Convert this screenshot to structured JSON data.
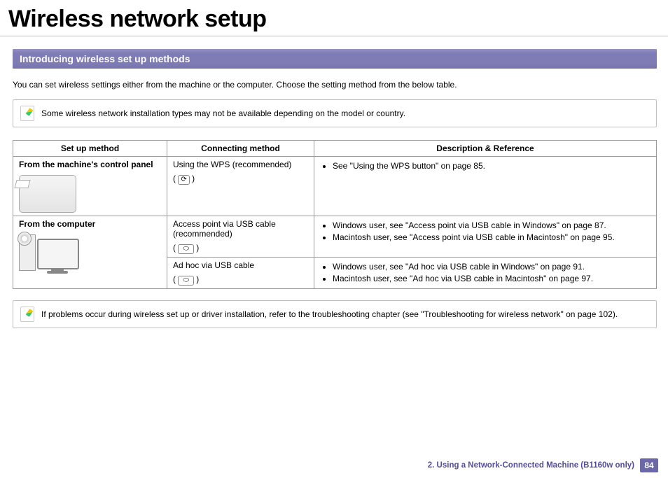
{
  "title": "Wireless network setup",
  "section_heading": "Introducing wireless set up methods",
  "intro_text": "You can set wireless settings either from the machine or the computer. Choose the setting method from the below table.",
  "note1": "Some wireless network installation types may not be available depending on the model or country.",
  "table": {
    "headers": [
      "Set up method",
      "Connecting method",
      "Description & Reference"
    ],
    "row1": {
      "setup": "From the machine's control panel",
      "connect": "Using the WPS (recommended)",
      "desc_item": "See \"Using the WPS button\" on page 85."
    },
    "row2": {
      "setup": "From the computer",
      "connect_a": "Access point via USB cable (recommended)",
      "desc_a1": "Windows user, see \"Access point via USB cable in Windows\" on page 87.",
      "desc_a2": "Macintosh user, see \"Access point via USB cable in Macintosh\" on page 95.",
      "connect_b": "Ad hoc via USB cable",
      "desc_b1": "Windows user, see \"Ad hoc via USB cable in Windows\" on page 91.",
      "desc_b2": "Macintosh user, see \"Ad hoc via USB cable in Macintosh\" on page 97."
    }
  },
  "note2": "If problems occur during wireless set up or driver installation, refer to the troubleshooting chapter (see \"Troubleshooting for wireless network\" on page 102).",
  "footer_chapter": "2.  Using a Network-Connected Machine (B1160w only)",
  "page_number": "84",
  "wps_btn_glyph": "⟳",
  "usb_btn_glyph": "⬭"
}
